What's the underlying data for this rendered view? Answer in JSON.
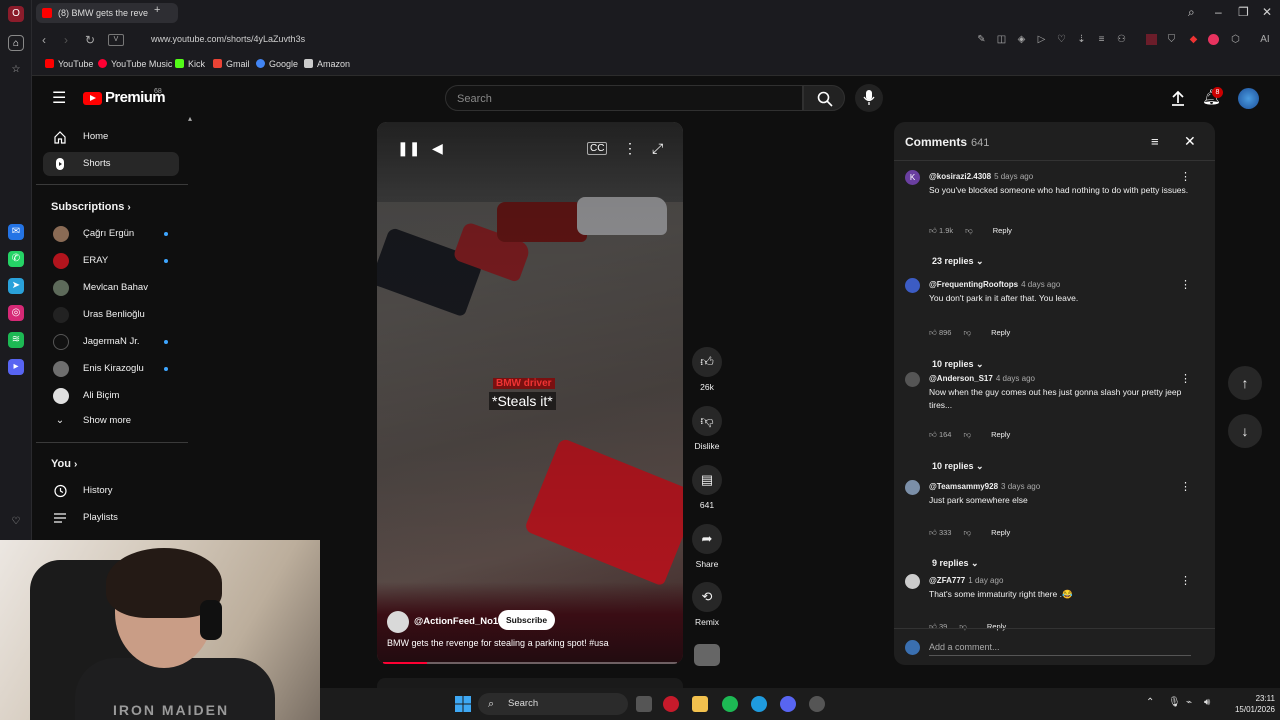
{
  "browser": {
    "tab_title": "(8) BMW gets the reve",
    "url": "www.youtube.com/shorts/4yLaZuvth3s",
    "bookmarks": [
      {
        "label": "YouTube",
        "color": "#ff0000"
      },
      {
        "label": "YouTube Music",
        "color": "#ff0033"
      },
      {
        "label": "Kick",
        "color": "#53fc18"
      },
      {
        "label": "Gmail",
        "color": "#ea4335"
      },
      {
        "label": "Google",
        "color": "#4285f4"
      },
      {
        "label": "Amazon",
        "color": "#cccccc"
      }
    ]
  },
  "youtube": {
    "logo_text": "Premium",
    "logo_badge": "68",
    "search_placeholder": "Search",
    "notifications_count": "8",
    "guide": {
      "home": "Home",
      "shorts": "Shorts",
      "subscriptions_header": "Subscriptions",
      "subscriptions": [
        {
          "name": "Çağrı Ergün",
          "live": true
        },
        {
          "name": "ERAY",
          "live": true
        },
        {
          "name": "Mevlcan Bahav",
          "live": false
        },
        {
          "name": "Uras Benlioğlu",
          "live": false
        },
        {
          "name": "JagermaN Jr.",
          "live": true
        },
        {
          "name": "Enis Kirazoglu",
          "live": true
        },
        {
          "name": "Ali Biçim",
          "live": false
        }
      ],
      "show_more": "Show more",
      "you_header": "You",
      "history": "History",
      "playlists": "Playlists"
    },
    "short": {
      "caption_top": "BMW driver",
      "caption_main": "*Steals it*",
      "channel": "@ActionFeed_No1",
      "subscribe": "Subscribe",
      "title": "BMW gets the revenge for stealing a parking spot! #usa",
      "progress_fraction": 0.15
    },
    "actions": {
      "likes": "26k",
      "dislike": "Dislike",
      "comments": "641",
      "share": "Share",
      "remix": "Remix"
    },
    "comments_panel": {
      "title": "Comments",
      "count": "641",
      "add_placeholder": "Add a comment...",
      "items": [
        {
          "author": "@kosirazi2.4308",
          "time": "5 days ago",
          "text": "So you've blocked someone who had nothing to do with petty issues.",
          "likes": "1.9k",
          "reply": "Reply",
          "replies": "23 replies",
          "avatar_letter": "K",
          "avatar_color": "#6a3fa0"
        },
        {
          "author": "@FrequentingRooftops",
          "time": "4 days ago",
          "text": "You don't park in it after that. You leave.",
          "likes": "896",
          "reply": "Reply",
          "replies": "10 replies",
          "avatar_letter": "",
          "avatar_color": "#3c5cc4"
        },
        {
          "author": "@Anderson_S17",
          "time": "4 days ago",
          "text": "Now when the guy comes out hes just gonna slash your pretty jeep tires...",
          "likes": "164",
          "reply": "Reply",
          "replies": "10 replies",
          "avatar_letter": "",
          "avatar_color": "#555555"
        },
        {
          "author": "@Teamsammy928",
          "time": "3 days ago",
          "text": "Just park somewhere else",
          "likes": "333",
          "reply": "Reply",
          "replies": "9 replies",
          "avatar_letter": "",
          "avatar_color": "#7b8fa8"
        },
        {
          "author": "@ZFA777",
          "time": "1 day ago",
          "text": "That's some immaturity right there .😂",
          "likes": "39",
          "reply": "Reply",
          "replies": "",
          "avatar_letter": "",
          "avatar_color": "#cccccc"
        }
      ]
    }
  },
  "taskbar": {
    "search": "Search",
    "time": "23:11",
    "date": "15/01/2026"
  },
  "webcam": {
    "shirt_text": "IRON MAIDEN"
  }
}
